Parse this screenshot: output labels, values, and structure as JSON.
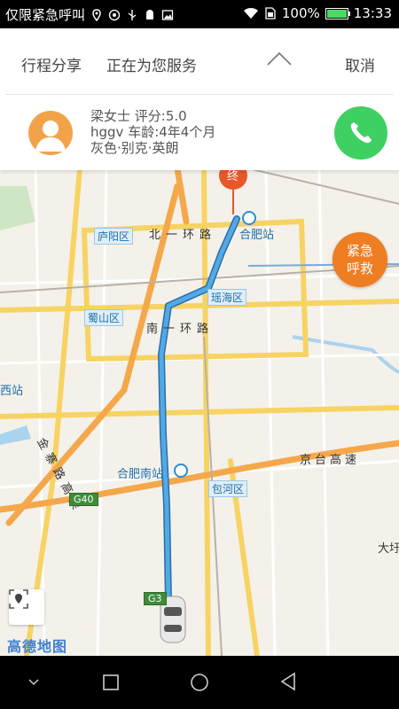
{
  "status_bar": {
    "carrier": "仅限紧急呼叫",
    "battery": "100%",
    "time": "13:33",
    "battery_level": 1.0
  },
  "panel": {
    "share_label": "行程分享",
    "serving_label": "正在为您服务",
    "cancel_label": "取消",
    "driver": {
      "name_line": "梁女士    评分:5.0",
      "plate_line": "hggv   车龄:4年4个月",
      "car_line": "灰色·别克·英朗"
    }
  },
  "map": {
    "station_top": "合肥站",
    "station_left": "西站",
    "station_south": "合肥南站",
    "district_luyang": "庐阳区",
    "district_yaohai": "瑶海区",
    "district_shushan": "蜀山区",
    "district_baohe": "包河区",
    "road_north": "北一环路",
    "road_south": "南一环路",
    "road_jinzhai": "金寨路高架",
    "road_jingtai": "京台高速",
    "place_right": "大圩",
    "badge_g40": "G40",
    "badge_g3": "G3",
    "end_marker": "终",
    "emergency_line1": "紧急",
    "emergency_line2": "呼救",
    "brand": "高德地图"
  },
  "colors": {
    "emergency": "#ef7d22",
    "call": "#3fd063",
    "route": "#3b8fd0",
    "avatar": "#f2a349"
  }
}
